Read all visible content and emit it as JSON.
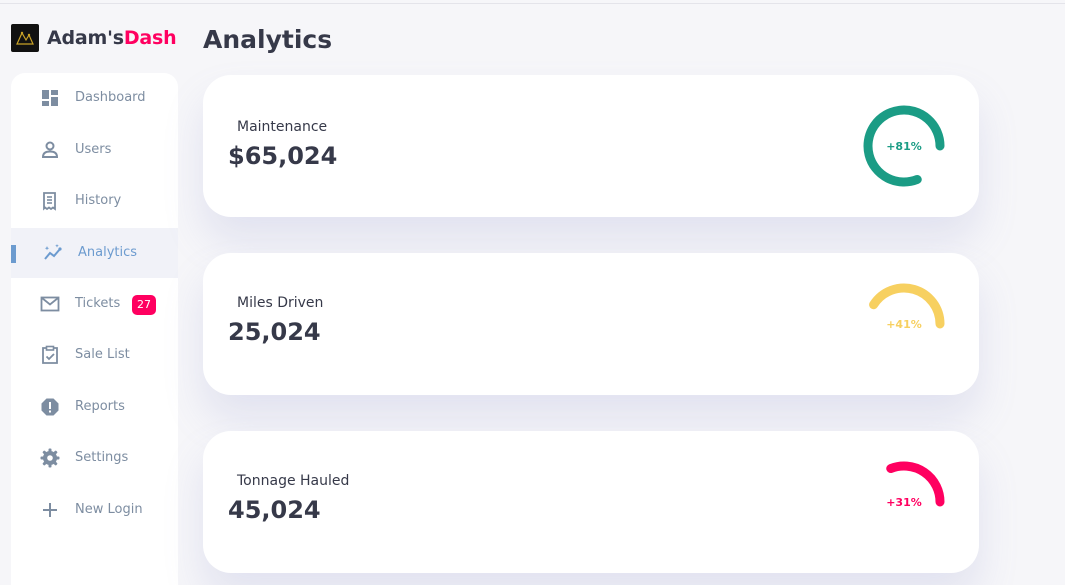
{
  "brand": {
    "name": "Adam's",
    "accent": "Dash"
  },
  "sidebar": {
    "items": [
      {
        "label": "Dashboard",
        "icon": "dashboard-icon"
      },
      {
        "label": "Users",
        "icon": "user-icon"
      },
      {
        "label": "History",
        "icon": "receipt-icon"
      },
      {
        "label": "Analytics",
        "icon": "insights-icon",
        "active": true
      },
      {
        "label": "Tickets",
        "icon": "mail-icon",
        "badge": "27"
      },
      {
        "label": "Sale List",
        "icon": "clipboard-check-icon"
      },
      {
        "label": "Reports",
        "icon": "report-icon"
      },
      {
        "label": "Settings",
        "icon": "gear-icon"
      },
      {
        "label": "New Login",
        "icon": "plus-icon"
      }
    ]
  },
  "main": {
    "title": "Analytics",
    "cards": [
      {
        "title": "Maintenance",
        "value": "$65,024",
        "percent_label": "+81%",
        "percent": 81,
        "color": "#1b9c85"
      },
      {
        "title": "Miles Driven",
        "value": "25,024",
        "percent_label": "+41%",
        "percent": 41,
        "color": "#f7d060"
      },
      {
        "title": "Tonnage Hauled",
        "value": "45,024",
        "percent_label": "+31%",
        "percent": 31,
        "color": "#ff0060"
      }
    ]
  },
  "colors": {
    "primary": "#6c9bcf",
    "danger": "#ff0060",
    "success": "#1b9c85",
    "warning": "#f7d060",
    "dark": "#363949",
    "muted": "#7d8da1",
    "background": "#f6f6f9"
  }
}
